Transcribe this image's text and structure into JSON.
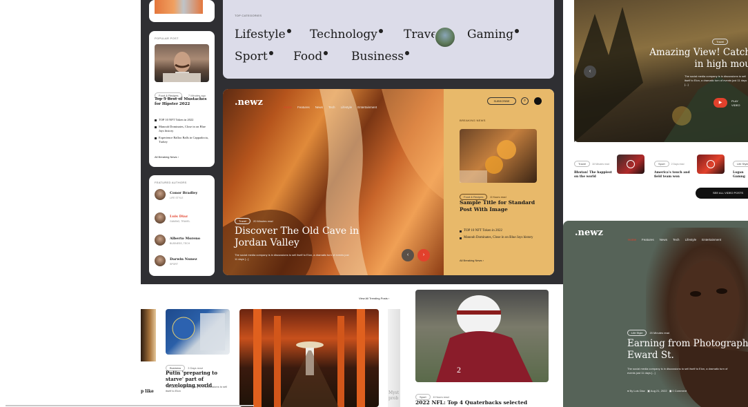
{
  "colors": {
    "accent": "#e2412c",
    "dark_bg": "#2f2f33",
    "lavender": "#dcdce9",
    "sand": "#e8b96a",
    "teal": "#566358"
  },
  "categories": {
    "heading": "TOP CATEGORIES",
    "items": [
      "Lifestyle",
      "Technology",
      "Travel",
      "Gaming",
      "Sport",
      "Food",
      "Business"
    ]
  },
  "popular": {
    "heading": "POPULAR POST",
    "chip": "Food & Recipes",
    "time": "7 Minutes ago",
    "title": "Top 5 Best of Mustaches for Hipster 2022",
    "bullets": [
      "TOP 10 NFT Token in 2022",
      "Manouh Dominates, Close in on Blue Jays history",
      "Experience Balloo Balls in Cappadocia, Turkey"
    ],
    "link": "All Breaking News"
  },
  "authors": {
    "heading": "FEATURED AUTHORS",
    "list": [
      {
        "name": "Conor Bradley",
        "role": "LIFE STYLE"
      },
      {
        "name": "Luis Diaz",
        "role": "GAMING, TRAVEL"
      },
      {
        "name": "Alberto Moreno",
        "role": "BUSINESS, TECH"
      },
      {
        "name": "Darwin Nunez",
        "role": "SPORT"
      }
    ]
  },
  "hero": {
    "logo": ".newz",
    "nav": [
      "Home",
      "Features",
      "News",
      "Tech",
      "Lifestyle",
      "Entertainment"
    ],
    "chip": "Travel",
    "time": "20 Minutes read",
    "title": "Discover The Old Cave in Jordan Valley",
    "desc": "The social media company is in discussions to sell itself to Elon, a dramatic turn of events just 11 days [...]",
    "subscribe": "SUBSCRIBE"
  },
  "breaking": {
    "heading": "BREAKING NEWS",
    "chip": "Food & Recipes",
    "time": "8 Hours read",
    "title": "Sample Title for Standard Post With Image",
    "bullets": [
      "TOP 10 NFT Token in 2022",
      "Manouh Dominates, Close in on Blue Jays history"
    ],
    "link": "All Breaking News"
  },
  "video": {
    "title_line1": "Amazing View! Catch",
    "title_line2": "in high mou",
    "chip": "Travel",
    "desc": "The social media company is in discussions to sell itself to Elon, a dramatic turn of events just 11 days [...]",
    "play": "PLAY",
    "play2": "VIDEO",
    "items": [
      {
        "chip": "Travel",
        "time": "18 Minutes read",
        "title": "Bhutan! The happiest on the world"
      },
      {
        "chip": "Sport",
        "time": "2 Days read",
        "title": "America's touch and field team won"
      },
      {
        "chip": "Life Style",
        "time": "",
        "title": "Logan Gamng"
      }
    ],
    "all": "SEE ALL VIDEO POSTS"
  },
  "trending": {
    "link": "View All Trending Posts",
    "chip": "Business",
    "time": "3 Days read",
    "title": "Putin 'preparing to starve' part of developing world",
    "desc": "The social media company is in discussions to sell itself to Elon",
    "left_title": "p like",
    "right_title": "Myst prob"
  },
  "nfl": {
    "chip": "Sport",
    "time": "8 Hours read",
    "title": "2022 NFL: Top 4 Quaterbacks selected"
  },
  "photo": {
    "logo": ".newz",
    "nav": [
      "Home",
      "Features",
      "News",
      "Tech",
      "Lifestyle",
      "Entertainment"
    ],
    "chip": "Life Style",
    "time": "20 Minutes read",
    "title_line1": "Earning from Photograph",
    "title_line2": "Eward St.",
    "desc": "The social media company is in discussions to sell itself to Elon, a dramatic turn of events just 11 days [...]",
    "author": "By Luis Diaz",
    "date": "Aug 21, 2022",
    "comments": "0 Comment"
  }
}
